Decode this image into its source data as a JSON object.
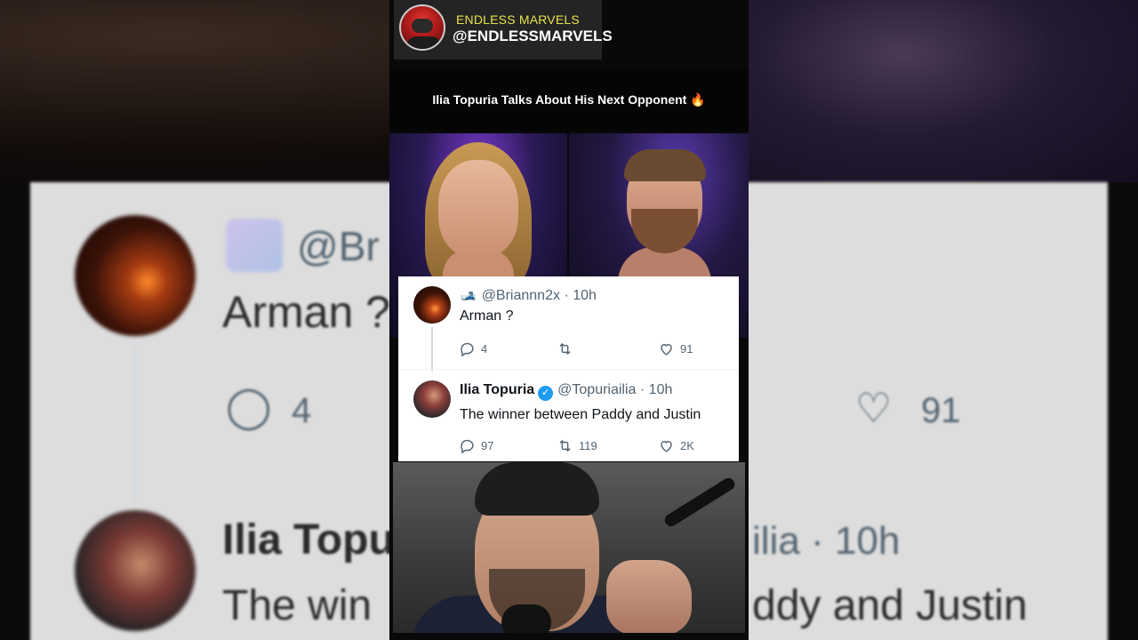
{
  "channel": {
    "name": "ENDLESS MARVELS",
    "handle": "@ENDLESSMARVELS"
  },
  "headline": {
    "text": "Ilia Topuria Talks About His Next Opponent",
    "emoji": "🔥"
  },
  "tweets": [
    {
      "display_name": "",
      "name_icon": "🎿",
      "handle": "@Briannn2x",
      "time": "· 10h",
      "body": "Arman ?",
      "replies": "4",
      "retweets": "",
      "likes": "91",
      "verified": false
    },
    {
      "display_name": "Ilia Topuria",
      "handle": "@Topuriailia",
      "time": "· 10h",
      "body": "The winner between Paddy and Justin",
      "replies": "97",
      "retweets": "119",
      "likes": "2K",
      "verified": true
    }
  ],
  "background_zoom": {
    "handle_fragment": "@Br",
    "reply_text": "Arman ?",
    "replies": "4",
    "likes": "91",
    "name_fragment": "Ilia Topu",
    "handle_fragment_2": "ilia · 10h",
    "body_fragment_left": "The win",
    "body_fragment_right": "ddy and Justin"
  },
  "colors": {
    "channel_name": "#e8e14a",
    "verified": "#1d9bf0",
    "muted_text": "#536471"
  }
}
